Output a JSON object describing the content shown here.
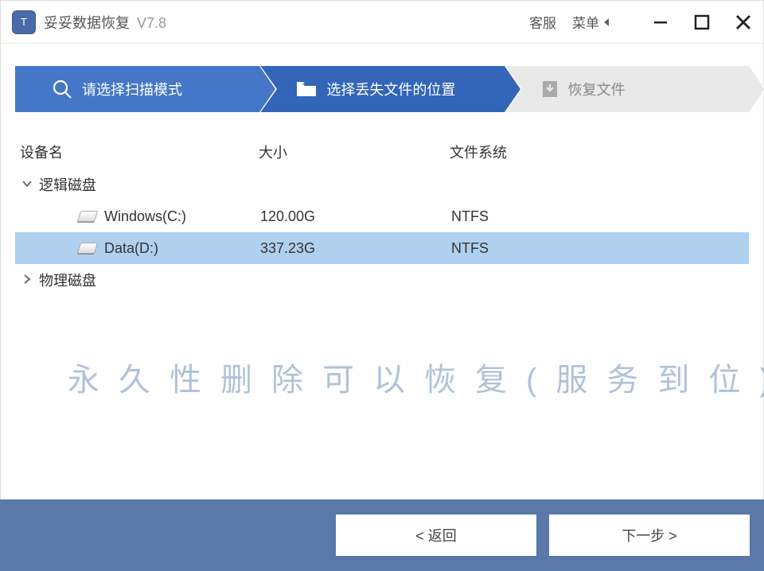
{
  "title": {
    "app_name": "妥妥数据恢复",
    "version": "V7.8"
  },
  "title_actions": {
    "support": "客服",
    "menu": "菜单"
  },
  "steps": {
    "s1": "请选择扫描模式",
    "s2": "选择丢失文件的位置",
    "s3": "恢复文件"
  },
  "table": {
    "headers": {
      "name": "设备名",
      "size": "大小",
      "fs": "文件系统"
    },
    "groups": {
      "logical": "逻辑磁盘",
      "physical": "物理磁盘"
    },
    "drives": [
      {
        "name": "Windows(C:)",
        "size": "120.00G",
        "fs": "NTFS"
      },
      {
        "name": "Data(D:)",
        "size": "337.23G",
        "fs": "NTFS"
      }
    ]
  },
  "footer": {
    "back": "< 返回",
    "next": "下一步 >"
  },
  "watermark": "永久性删除可以恢复(服务到位)恢复"
}
